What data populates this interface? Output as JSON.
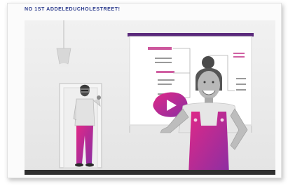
{
  "headline": "NO 1ST ADDELEDUCHOLESTREET!",
  "colors": {
    "accent_magenta": "#d01c7e",
    "accent_purple": "#8a2fa3",
    "headline_blue": "#2a3a8c",
    "board_frame": "#e6e6e6",
    "floor": "#2f2f2f"
  },
  "icons": {
    "play": "play-icon",
    "lamp": "ceiling-lamp-icon"
  }
}
